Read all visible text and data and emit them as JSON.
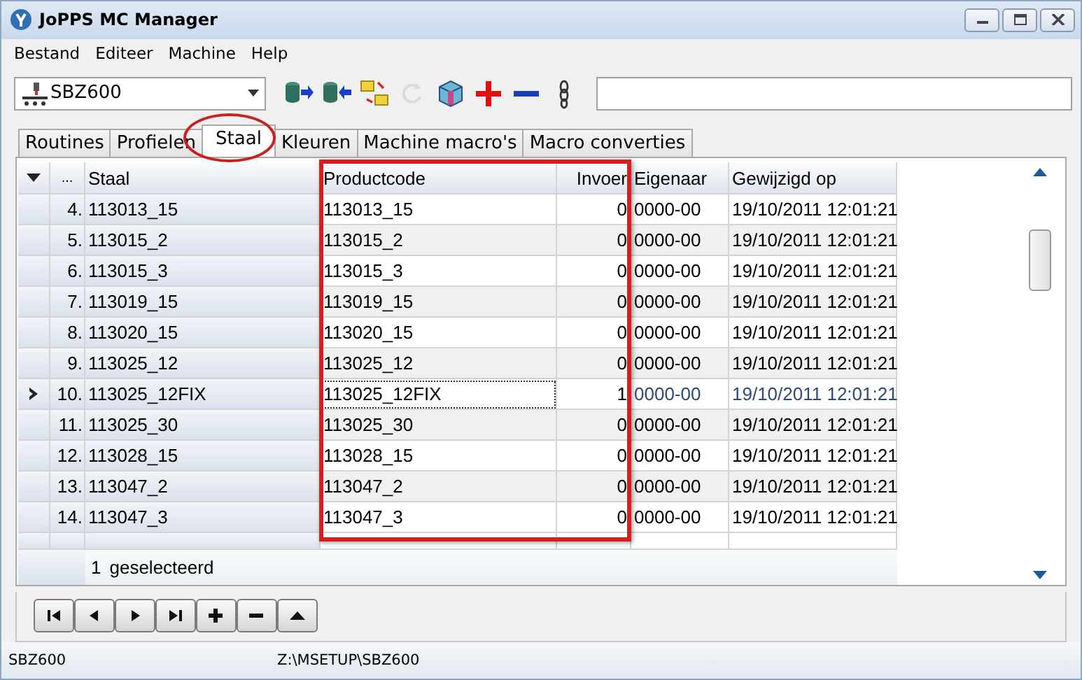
{
  "window": {
    "title": "JoPPS MC Manager"
  },
  "menu": [
    "Bestand",
    "Editeer",
    "Machine",
    "Help"
  ],
  "toolbar": {
    "machine": "SBZ600",
    "tools": [
      {
        "kind": "export",
        "disabled": false
      },
      {
        "kind": "import",
        "disabled": false
      },
      {
        "kind": "swap",
        "disabled": false
      },
      {
        "kind": "refresh",
        "disabled": true
      },
      {
        "kind": "cube",
        "disabled": false
      },
      {
        "kind": "add",
        "disabled": false
      },
      {
        "kind": "remove",
        "disabled": false
      },
      {
        "kind": "link",
        "disabled": false
      }
    ]
  },
  "tabs": [
    {
      "label": "Routines",
      "selected": false
    },
    {
      "label": "Profielen",
      "selected": false
    },
    {
      "label": "Staal",
      "selected": true
    },
    {
      "label": "Kleuren",
      "selected": false
    },
    {
      "label": "Machine macro's",
      "selected": false
    },
    {
      "label": "Macro converties",
      "selected": false
    }
  ],
  "table": {
    "columns": [
      "...",
      "Staal",
      "Productcode",
      "Invoer",
      "Eigenaar",
      "Gewijzigd op"
    ],
    "rows": [
      {
        "number": "4.",
        "staal": "113013_15",
        "productcode": "113013_15",
        "invoer": "0",
        "eigenaar": "0000-00",
        "gewijzigd": "19/10/2011 12:01:21",
        "selected": false
      },
      {
        "number": "5.",
        "staal": "113015_2",
        "productcode": "113015_2",
        "invoer": "0",
        "eigenaar": "0000-00",
        "gewijzigd": "19/10/2011 12:01:21",
        "selected": false
      },
      {
        "number": "6.",
        "staal": "113015_3",
        "productcode": "113015_3",
        "invoer": "0",
        "eigenaar": "0000-00",
        "gewijzigd": "19/10/2011 12:01:21",
        "selected": false
      },
      {
        "number": "7.",
        "staal": "113019_15",
        "productcode": "113019_15",
        "invoer": "0",
        "eigenaar": "0000-00",
        "gewijzigd": "19/10/2011 12:01:21",
        "selected": false
      },
      {
        "number": "8.",
        "staal": "113020_15",
        "productcode": "113020_15",
        "invoer": "0",
        "eigenaar": "0000-00",
        "gewijzigd": "19/10/2011 12:01:21",
        "selected": false
      },
      {
        "number": "9.",
        "staal": "113025_12",
        "productcode": "113025_12",
        "invoer": "0",
        "eigenaar": "0000-00",
        "gewijzigd": "19/10/2011 12:01:21",
        "selected": false
      },
      {
        "number": "10.",
        "staal": "113025_12FIX",
        "productcode": "113025_12FIX",
        "invoer": "1",
        "eigenaar": "0000-00",
        "gewijzigd": "19/10/2011 12:01:21",
        "selected": true
      },
      {
        "number": "11.",
        "staal": "113025_30",
        "productcode": "113025_30",
        "invoer": "0",
        "eigenaar": "0000-00",
        "gewijzigd": "19/10/2011 12:01:21",
        "selected": false
      },
      {
        "number": "12.",
        "staal": "113028_15",
        "productcode": "113028_15",
        "invoer": "0",
        "eigenaar": "0000-00",
        "gewijzigd": "19/10/2011 12:01:21",
        "selected": false
      },
      {
        "number": "13.",
        "staal": "113047_2",
        "productcode": "113047_2",
        "invoer": "0",
        "eigenaar": "0000-00",
        "gewijzigd": "19/10/2011 12:01:21",
        "selected": false
      },
      {
        "number": "14.",
        "staal": "113047_3",
        "productcode": "113047_3",
        "invoer": "0",
        "eigenaar": "0000-00",
        "gewijzigd": "19/10/2011 12:01:21",
        "selected": false
      }
    ],
    "footer_count": "1",
    "footer_label": "geselecteerd"
  },
  "navigator": [
    {
      "kind": "first"
    },
    {
      "kind": "prev"
    },
    {
      "kind": "next"
    },
    {
      "kind": "last"
    },
    {
      "kind": "add"
    },
    {
      "kind": "delete"
    },
    {
      "kind": "up"
    }
  ],
  "status_bar": [
    "SBZ600",
    "Z:\\MSETUP\\SBZ600"
  ],
  "annotations": [
    {
      "kind": "ellipse"
    },
    {
      "kind": "rectangle"
    }
  ]
}
